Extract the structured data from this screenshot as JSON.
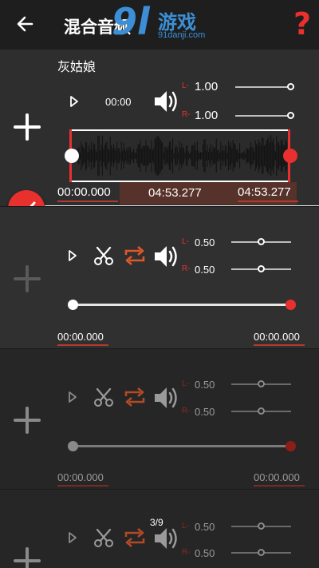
{
  "header": {
    "title": "混合音频",
    "logo_mark": "9l",
    "logo_text": "游戏",
    "logo_domain": "91danji.com",
    "help_label": "?"
  },
  "colors": {
    "accent": "#e8302f",
    "repeat": "#e0572a",
    "logo": "#3c8fd6"
  },
  "tracks": [
    {
      "name": "灰姑娘",
      "play_time": "00:00",
      "left_label": "L-",
      "left_value": "1.00",
      "right_label": "R-",
      "right_value": "1.00",
      "start_time": "00:00.000",
      "mid_time": "04:53.277",
      "end_time": "04:53.277",
      "selected": true
    },
    {
      "left_label": "L-",
      "left_value": "0.50",
      "right_label": "R-",
      "right_value": "0.50",
      "start_time": "00:00.000",
      "end_time": "00:00.000"
    },
    {
      "left_label": "L-",
      "left_value": "0.50",
      "right_label": "R-",
      "right_value": "0.50",
      "start_time": "00:00.000",
      "end_time": "00:00.000"
    },
    {
      "counter": "3/9",
      "left_label": "L-",
      "left_value": "0.50",
      "right_label": "R-",
      "right_value": "0.50"
    }
  ]
}
